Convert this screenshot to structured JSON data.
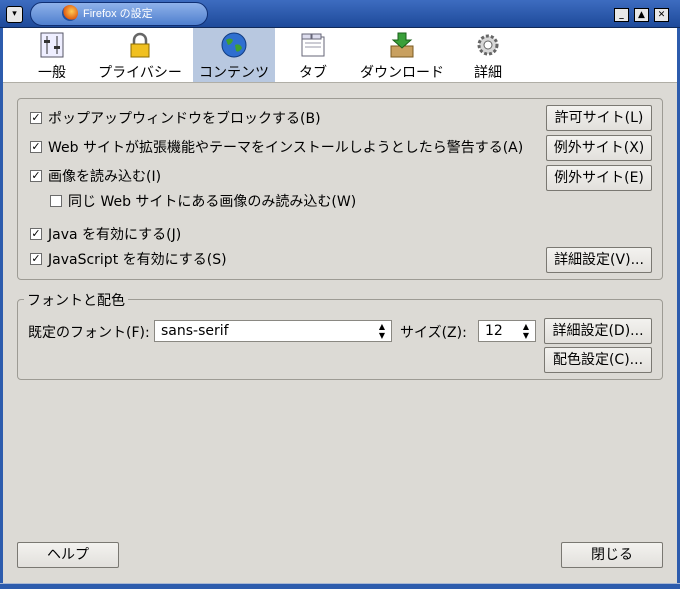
{
  "window": {
    "title": "Firefox の設定",
    "menu_glyph": "▾",
    "minimize_glyph": "_",
    "maximize_glyph": "▲",
    "close_glyph": "✕"
  },
  "tabs": [
    {
      "label": "一般",
      "icon": "sliders-icon"
    },
    {
      "label": "プライバシー",
      "icon": "lock-icon"
    },
    {
      "label": "コンテンツ",
      "icon": "globe-icon",
      "selected": true
    },
    {
      "label": "タブ",
      "icon": "tabs-icon"
    },
    {
      "label": "ダウンロード",
      "icon": "download-icon"
    },
    {
      "label": "詳細",
      "icon": "gear-icon"
    }
  ],
  "content": {
    "check_glyph": "✓",
    "popup_block": {
      "label": "ポップアップウィンドウをブロックする(B)",
      "checked": true
    },
    "warn_install": {
      "label": "Web サイトが拡張機能やテーマをインストールしようとしたら警告する(A)",
      "checked": true
    },
    "load_images": {
      "label": "画像を読み込む(I)",
      "checked": true
    },
    "same_site_images": {
      "label": "同じ Web サイトにある画像のみ読み込む(W)",
      "checked": false
    },
    "enable_java": {
      "label": "Java を有効にする(J)",
      "checked": true
    },
    "enable_js": {
      "label": "JavaScript を有効にする(S)",
      "checked": true
    },
    "allowed_sites_btn": "許可サイト(L)",
    "exceptions_btn_1": "例外サイト(X)",
    "exceptions_btn_2": "例外サイト(E)",
    "advanced_js_btn": "詳細設定(V)..."
  },
  "fonts": {
    "legend": "フォントと配色",
    "default_font_label": "既定のフォント(F):",
    "default_font_value": "sans-serif",
    "size_label": "サイズ(Z):",
    "size_value": "12",
    "advanced_btn": "詳細設定(D)...",
    "colors_btn": "配色設定(C)...",
    "spin_up": "▲",
    "spin_down": "▼"
  },
  "footer": {
    "help_btn": "ヘルプ",
    "close_btn": "閉じる"
  }
}
